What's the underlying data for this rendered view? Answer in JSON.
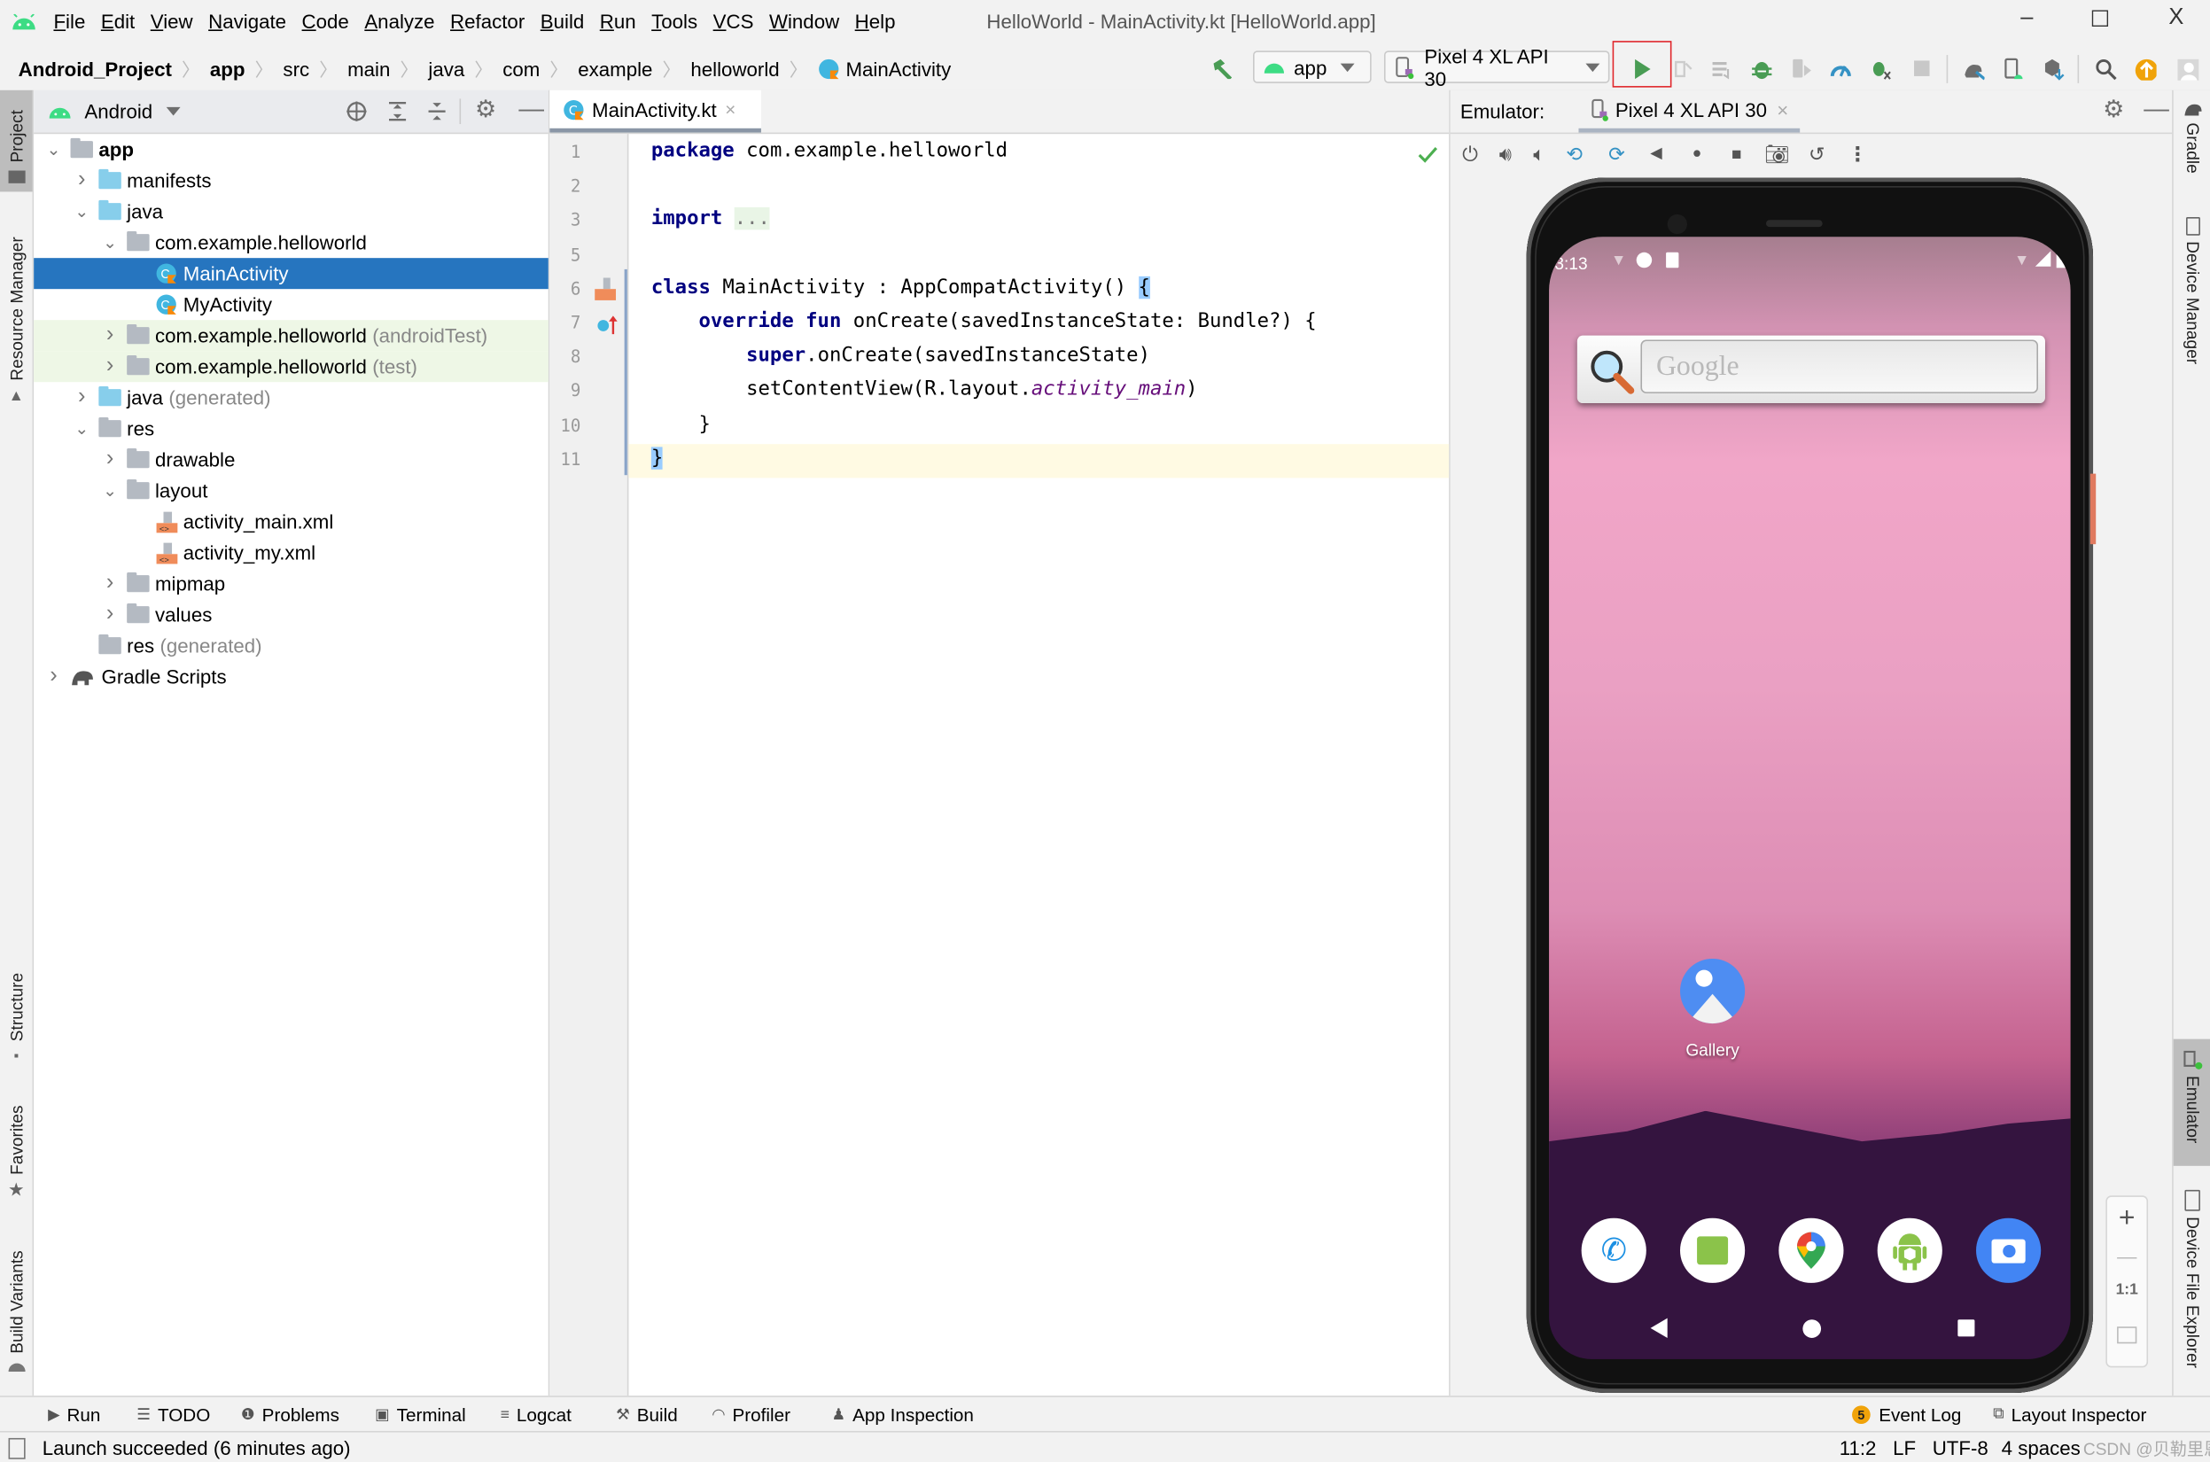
{
  "window": {
    "title": "HelloWorld - MainActivity.kt [HelloWorld.app]",
    "controls": {
      "minimize": "–",
      "maximize": "☐",
      "close": "X"
    }
  },
  "menu": [
    "File",
    "Edit",
    "View",
    "Navigate",
    "Code",
    "Analyze",
    "Refactor",
    "Build",
    "Run",
    "Tools",
    "VCS",
    "Window",
    "Help"
  ],
  "breadcrumb": [
    "Android_Project",
    "app",
    "src",
    "main",
    "java",
    "com",
    "example",
    "helloworld",
    "MainActivity"
  ],
  "toolbar": {
    "run_config": "app",
    "device": "Pixel 4 XL API 30",
    "icons": [
      "hammer-icon",
      "run-icon",
      "apply-changes-icon",
      "apply-code-changes-icon",
      "debug-icon",
      "attach-debugger-icon",
      "profile-icon",
      "debug-apk-icon",
      "stop-icon",
      "sync-gradle-icon",
      "avd-manager-icon",
      "sdk-manager-icon",
      "search-icon",
      "update-icon",
      "account-icon"
    ]
  },
  "left_stripe": {
    "tabs": [
      "Project",
      "Resource Manager",
      "Structure",
      "Favorites",
      "Build Variants"
    ]
  },
  "project_panel": {
    "view_mode": "Android",
    "tree": [
      {
        "label": "app",
        "bold": true,
        "depth": 0,
        "expanded": true,
        "icon": "module-folder"
      },
      {
        "label": "manifests",
        "depth": 1,
        "expanded": false,
        "icon": "blue-folder"
      },
      {
        "label": "java",
        "depth": 1,
        "expanded": true,
        "icon": "blue-folder"
      },
      {
        "label": "com.example.helloworld",
        "depth": 2,
        "expanded": true,
        "icon": "package-folder"
      },
      {
        "label": "MainActivity",
        "depth": 3,
        "icon": "kotlin-class",
        "selected": true
      },
      {
        "label": "MyActivity",
        "depth": 3,
        "icon": "kotlin-class"
      },
      {
        "label": "com.example.helloworld",
        "suffix": "(androidTest)",
        "depth": 2,
        "expanded": false,
        "icon": "package-folder",
        "test": true
      },
      {
        "label": "com.example.helloworld",
        "suffix": "(test)",
        "depth": 2,
        "expanded": false,
        "icon": "package-folder",
        "test": true
      },
      {
        "label": "java",
        "suffix": "(generated)",
        "depth": 1,
        "expanded": false,
        "icon": "generated-folder"
      },
      {
        "label": "res",
        "depth": 1,
        "expanded": true,
        "icon": "res-folder"
      },
      {
        "label": "drawable",
        "depth": 2,
        "expanded": false,
        "icon": "package-folder"
      },
      {
        "label": "layout",
        "depth": 2,
        "expanded": true,
        "icon": "package-folder"
      },
      {
        "label": "activity_main.xml",
        "depth": 3,
        "icon": "xml-file"
      },
      {
        "label": "activity_my.xml",
        "depth": 3,
        "icon": "xml-file"
      },
      {
        "label": "mipmap",
        "depth": 2,
        "expanded": false,
        "icon": "package-folder"
      },
      {
        "label": "values",
        "depth": 2,
        "expanded": false,
        "icon": "package-folder"
      },
      {
        "label": "res",
        "suffix": "(generated)",
        "depth": 1,
        "icon": "res-folder"
      },
      {
        "label": "Gradle Scripts",
        "depth": 0,
        "expanded": false,
        "icon": "gradle-elephant"
      }
    ]
  },
  "editor": {
    "tab": "MainActivity.kt",
    "lines": [
      {
        "n": "1",
        "parts": [
          {
            "t": "package",
            "c": "kw"
          },
          {
            "t": " com.example.helloworld"
          }
        ]
      },
      {
        "n": "2",
        "parts": []
      },
      {
        "n": "3",
        "parts": [
          {
            "t": "import",
            "c": "kw"
          },
          {
            "t": " "
          },
          {
            "t": "...",
            "c": "fold"
          }
        ]
      },
      {
        "n": "5",
        "parts": []
      },
      {
        "n": "6",
        "parts": [
          {
            "t": "class",
            "c": "kw"
          },
          {
            "t": " MainActivity : AppCompatActivity() "
          },
          {
            "t": "{",
            "c": "brace"
          }
        ]
      },
      {
        "n": "7",
        "parts": [
          {
            "t": "    "
          },
          {
            "t": "override fun",
            "c": "kw"
          },
          {
            "t": " onCreate(savedInstanceState: Bundle?) {"
          }
        ]
      },
      {
        "n": "8",
        "parts": [
          {
            "t": "        "
          },
          {
            "t": "super",
            "c": "kw"
          },
          {
            "t": ".onCreate(savedInstanceState)"
          }
        ]
      },
      {
        "n": "9",
        "parts": [
          {
            "t": "        setContentView(R.layout."
          },
          {
            "t": "activity_main",
            "c": "it"
          },
          {
            "t": ")"
          }
        ]
      },
      {
        "n": "10",
        "parts": [
          {
            "t": "    }"
          }
        ]
      },
      {
        "n": "11",
        "parts": [
          {
            "t": "}",
            "c": "brace"
          }
        ],
        "current": true
      }
    ]
  },
  "emulator": {
    "label": "Emulator:",
    "tab": "Pixel 4 XL API 30",
    "controls": [
      "power-icon",
      "volume-up-icon",
      "volume-down-icon",
      "rotate-left-icon",
      "rotate-right-icon",
      "back-icon",
      "home-icon",
      "overview-icon",
      "screenshot-icon",
      "snapshot-icon",
      "more-icon"
    ],
    "zoom": {
      "in": "+",
      "out": "—",
      "actual": "1:1"
    },
    "phone": {
      "time": "3:13",
      "search_placeholder": "Google",
      "apps": [
        {
          "label": "Gallery"
        }
      ],
      "dock": [
        "phone-app",
        "messages-app",
        "maps-app",
        "android-app",
        "camera-app"
      ]
    }
  },
  "right_stripe": {
    "tabs": [
      "Gradle",
      "Device Manager",
      "Emulator",
      "Device File Explorer"
    ]
  },
  "bottom_tools": {
    "left": [
      "Run",
      "TODO",
      "Problems",
      "Terminal",
      "Logcat",
      "Build",
      "Profiler",
      "App Inspection"
    ],
    "event_log": {
      "label": "Event Log",
      "count": "5"
    },
    "layout_inspector": "Layout Inspector"
  },
  "status": {
    "message": "Launch succeeded (6 minutes ago)",
    "position": "11:2",
    "line_sep": "LF",
    "encoding": "UTF-8",
    "indent": "4 spaces",
    "watermark": "CSDN @贝勒里恩"
  },
  "colors": {
    "selection": "#2675bf",
    "run_green": "#499c54",
    "highlight_box": "#e0262b",
    "android_green": "#3ddc84"
  }
}
